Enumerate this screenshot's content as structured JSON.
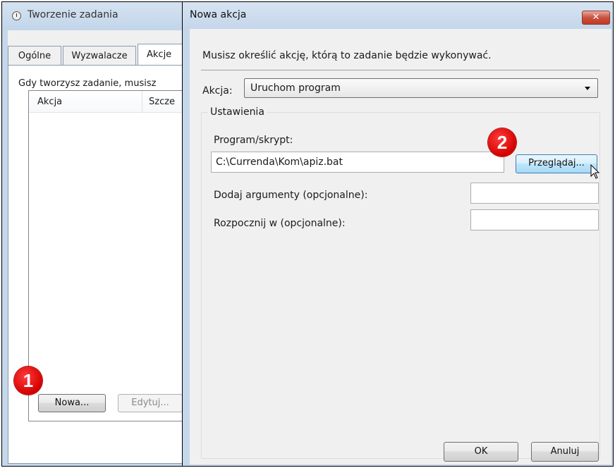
{
  "background_window": {
    "title": "Tworzenie zadania",
    "tabs": [
      "Ogólne",
      "Wyzwalacze",
      "Akcje"
    ],
    "description": "Gdy tworzysz zadanie, musisz",
    "list_columns": [
      "Akcja",
      "Szcze"
    ],
    "buttons": {
      "new": "Nowa...",
      "edit": "Edytuj..."
    }
  },
  "dialog": {
    "title": "Nowa akcja",
    "close_glyph": "✕",
    "instruction": "Musisz określić akcję, którą to zadanie będzie wykonywać.",
    "action_label": "Akcja:",
    "action_value": "Uruchom program",
    "settings_group": "Ustawienia",
    "program_label": "Program/skrypt:",
    "program_value": "C:\\Currenda\\Kom\\apiz.bat",
    "browse_button": "Przeglądaj...",
    "args_label": "Dodaj argumenty (opcjonalne):",
    "args_value": "",
    "start_label": "Rozpocznij w (opcjonalne):",
    "start_value": "",
    "ok_button": "OK",
    "cancel_button": "Anuluj"
  },
  "annotations": {
    "step1": "1",
    "step2": "2"
  },
  "colors": {
    "badge": "#d40000",
    "titlebar": "#c5d7ea",
    "dialog_bg": "#f0f0f0",
    "close": "#c23a25"
  }
}
